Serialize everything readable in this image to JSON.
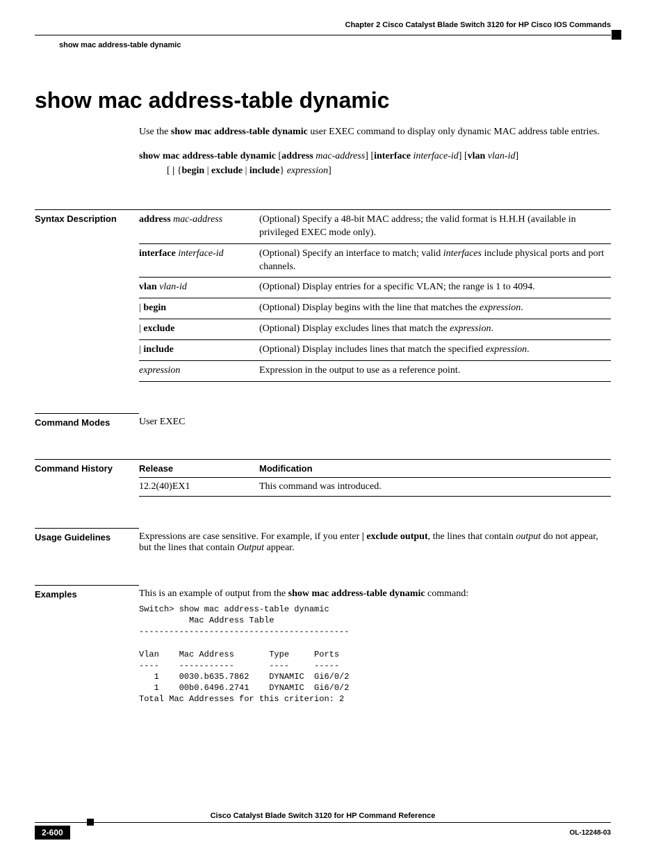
{
  "header": {
    "chapter": "Chapter 2      Cisco Catalyst Blade Switch 3120 for HP Cisco IOS Commands",
    "section": "show mac address-table dynamic"
  },
  "title": "show mac address-table dynamic",
  "intro": {
    "pre": "Use the ",
    "cmd": "show mac address-table dynamic",
    "post": " user EXEC command to display only dynamic MAC address table entries."
  },
  "syntax": {
    "cmd": "show mac address-table dynamic",
    "opt1_kw": "address",
    "opt1_arg": "mac-address",
    "opt2_kw": "interface",
    "opt2_arg": "interface-id",
    "opt3_kw": "vlan",
    "opt3_arg": "vlan-id",
    "line2_begin": "begin",
    "line2_exclude": "exclude",
    "line2_include": "include",
    "line2_expr": "expression"
  },
  "sections": {
    "syntax_desc": "Syntax Description",
    "cmd_modes": "Command Modes",
    "cmd_history": "Command History",
    "usage": "Usage Guidelines",
    "examples": "Examples"
  },
  "syntax_table": [
    {
      "kw": "address",
      "arg": "mac-address",
      "desc_pre": "(Optional) Specify a 48-bit MAC address; the valid format is H.H.H (available in privileged EXEC mode only).",
      "desc_post": ""
    },
    {
      "kw": "interface",
      "arg": "interface-id",
      "desc_pre": "(Optional) Specify an interface to match; valid ",
      "desc_i": "interfaces",
      "desc_post": " include physical ports and port channels."
    },
    {
      "kw": "vlan",
      "arg": "vlan-id",
      "desc_pre": "(Optional) Display entries for a specific VLAN; the range is 1 to 4094.",
      "desc_post": ""
    },
    {
      "pipe": "|",
      "kw": "begin",
      "desc_pre": "(Optional) Display begins with the line that matches the ",
      "desc_i": "expression",
      "desc_post": "."
    },
    {
      "pipe": "|",
      "kw": "exclude",
      "desc_pre": "(Optional) Display excludes lines that match the ",
      "desc_i": "expression",
      "desc_post": "."
    },
    {
      "pipe": "|",
      "kw": "include",
      "desc_pre": "(Optional) Display includes lines that match the specified ",
      "desc_i": "expression",
      "desc_post": "."
    },
    {
      "arg": "expression",
      "desc_pre": "Expression in the output to use as a reference point.",
      "desc_post": ""
    }
  ],
  "cmd_modes_text": "User EXEC",
  "history": {
    "h_release": "Release",
    "h_mod": "Modification",
    "release": "12.2(40)EX1",
    "mod": "This command was introduced."
  },
  "usage_text": {
    "p1": "Expressions are case sensitive. For example, if you enter ",
    "b1": "| exclude output",
    "p2": ", the lines that contain ",
    "i1": "output",
    "p3": " do not appear, but the lines that contain ",
    "i2": "Output",
    "p4": " appear."
  },
  "examples_text": {
    "p1": "This is an example of output from the ",
    "b1": "show mac address-table dynamic",
    "p2": " command:"
  },
  "example_output": "Switch> show mac address-table dynamic\n          Mac Address Table\n------------------------------------------\n\nVlan    Mac Address       Type     Ports\n----    -----------       ----     -----\n   1    0030.b635.7862    DYNAMIC  Gi6/0/2\n   1    00b0.6496.2741    DYNAMIC  Gi6/0/2\nTotal Mac Addresses for this criterion: 2",
  "footer": {
    "title": "Cisco Catalyst Blade Switch 3120 for HP Command Reference",
    "page": "2-600",
    "doc": "OL-12248-03"
  }
}
